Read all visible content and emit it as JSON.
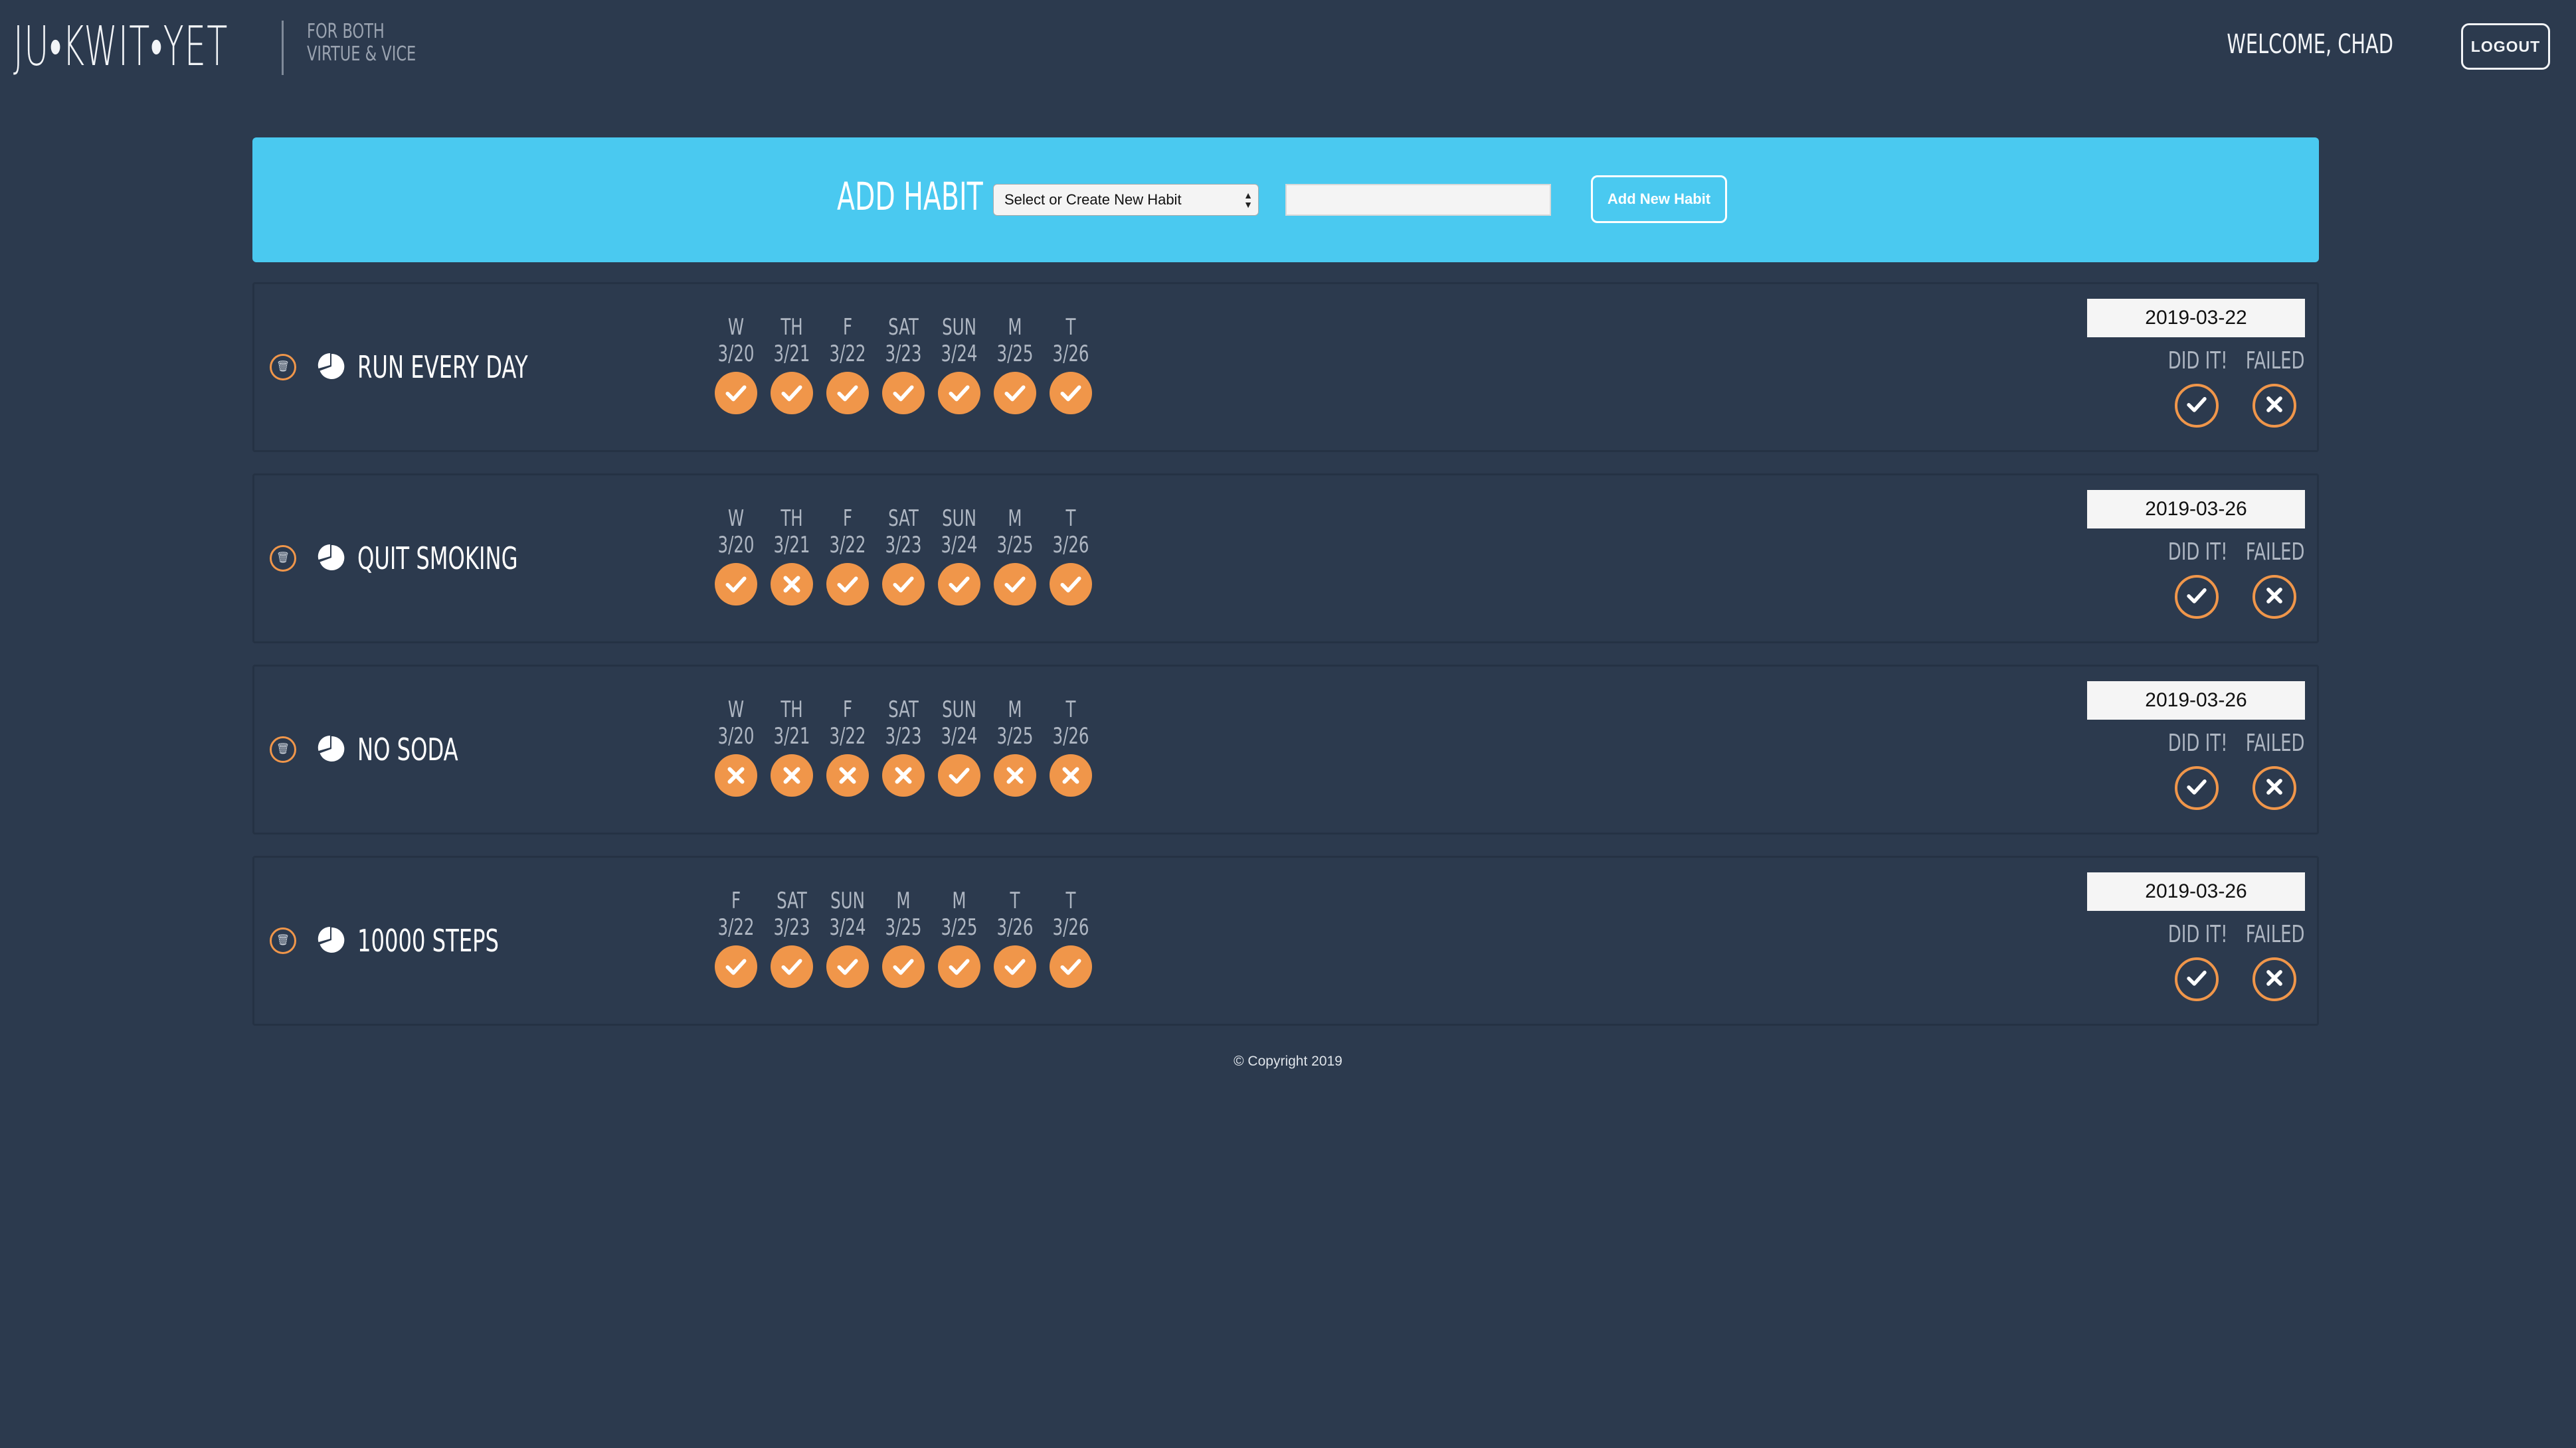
{
  "header": {
    "logo": "JU•KWIT•YET",
    "tagline_line1": "FOR BOTH",
    "tagline_line2": "VIRTUE & VICE",
    "welcome": "WELCOME, CHAD",
    "logout_label": "LOGOUT"
  },
  "add_habit": {
    "title": "ADD HABIT",
    "select_value": "Select or Create New Habit",
    "input_value": "",
    "button_label": "Add New Habit"
  },
  "labels": {
    "did_it": "DID IT!",
    "failed": "FAILED"
  },
  "colors": {
    "background": "#2c3a4e",
    "accent_blue": "#4ac9f0",
    "accent_orange": "#f0964a"
  },
  "habits": [
    {
      "name": "RUN EVERY DAY",
      "date": "2019-03-22",
      "days": [
        {
          "label": "W",
          "date": "3/20",
          "status": "done"
        },
        {
          "label": "TH",
          "date": "3/21",
          "status": "done"
        },
        {
          "label": "F",
          "date": "3/22",
          "status": "done"
        },
        {
          "label": "SAT",
          "date": "3/23",
          "status": "done"
        },
        {
          "label": "SUN",
          "date": "3/24",
          "status": "done"
        },
        {
          "label": "M",
          "date": "3/25",
          "status": "done"
        },
        {
          "label": "T",
          "date": "3/26",
          "status": "done"
        }
      ]
    },
    {
      "name": "QUIT SMOKING",
      "date": "2019-03-26",
      "days": [
        {
          "label": "W",
          "date": "3/20",
          "status": "done"
        },
        {
          "label": "TH",
          "date": "3/21",
          "status": "failed"
        },
        {
          "label": "F",
          "date": "3/22",
          "status": "done"
        },
        {
          "label": "SAT",
          "date": "3/23",
          "status": "done"
        },
        {
          "label": "SUN",
          "date": "3/24",
          "status": "done"
        },
        {
          "label": "M",
          "date": "3/25",
          "status": "done"
        },
        {
          "label": "T",
          "date": "3/26",
          "status": "done"
        }
      ]
    },
    {
      "name": "NO SODA",
      "date": "2019-03-26",
      "days": [
        {
          "label": "W",
          "date": "3/20",
          "status": "failed"
        },
        {
          "label": "TH",
          "date": "3/21",
          "status": "failed"
        },
        {
          "label": "F",
          "date": "3/22",
          "status": "failed"
        },
        {
          "label": "SAT",
          "date": "3/23",
          "status": "failed"
        },
        {
          "label": "SUN",
          "date": "3/24",
          "status": "done"
        },
        {
          "label": "M",
          "date": "3/25",
          "status": "failed"
        },
        {
          "label": "T",
          "date": "3/26",
          "status": "failed"
        }
      ]
    },
    {
      "name": "10000 STEPS",
      "date": "2019-03-26",
      "days": [
        {
          "label": "F",
          "date": "3/22",
          "status": "done"
        },
        {
          "label": "SAT",
          "date": "3/23",
          "status": "done"
        },
        {
          "label": "SUN",
          "date": "3/24",
          "status": "done"
        },
        {
          "label": "M",
          "date": "3/25",
          "status": "done"
        },
        {
          "label": "M",
          "date": "3/25",
          "status": "done"
        },
        {
          "label": "T",
          "date": "3/26",
          "status": "done"
        },
        {
          "label": "T",
          "date": "3/26",
          "status": "done"
        }
      ]
    }
  ],
  "footer": {
    "copyright": "© Copyright 2019"
  }
}
